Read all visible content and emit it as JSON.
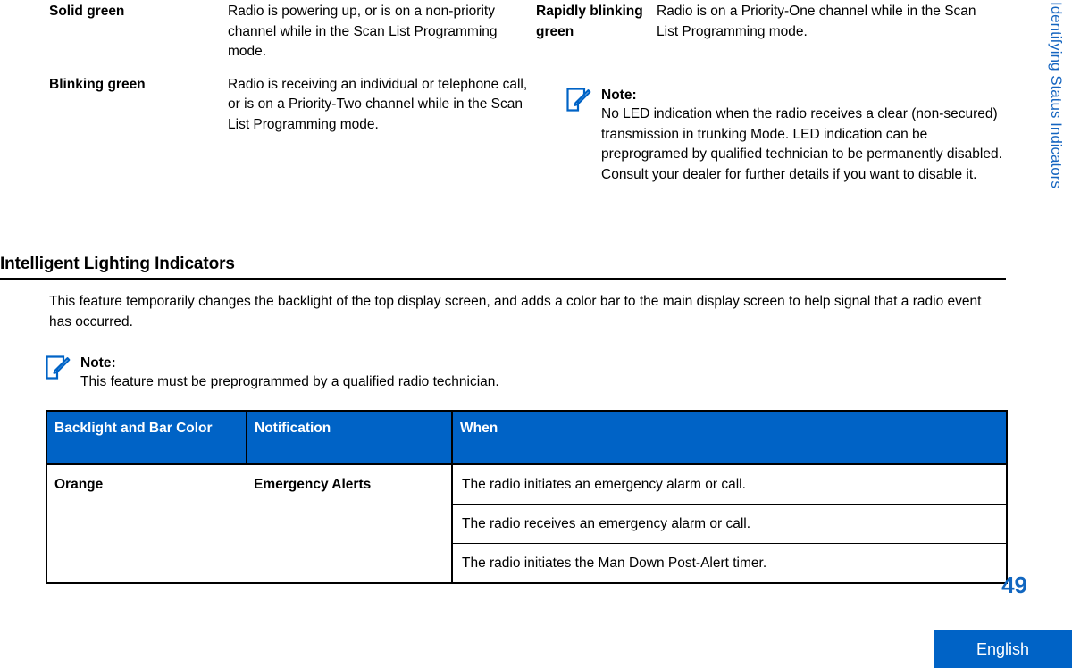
{
  "side_tab": {
    "label": "Identifying Status Indicators"
  },
  "led_table": {
    "left_rows": [
      {
        "term": "Solid green",
        "desc": "Radio is powering up, or is on a non-priority channel while in the Scan List Programming mode."
      },
      {
        "term": "Blinking green",
        "desc": "Radio is receiving an individual or telephone call, or is on a Priority-Two channel while in the Scan List Programming mode."
      }
    ],
    "right_rows": [
      {
        "term": "Rapidly blinking green",
        "desc": "Radio is on a Priority-One channel while in the Scan List Programming mode."
      }
    ]
  },
  "note_led": {
    "icon": "note-pencil-icon",
    "title": "Note:",
    "body": "No LED indication when the radio receives a clear (non-secured) transmission in trunking Mode. LED indication can be preprogramed by qualified technician to be permanently disabled. Consult your dealer for further details if you want to disable it."
  },
  "section": {
    "heading": "Intelligent Lighting Indicators",
    "paragraph": "This feature temporarily changes the backlight of the top display screen, and adds a color bar to the main display screen to help signal that a radio event has occurred."
  },
  "note_feature": {
    "icon": "note-pencil-icon",
    "title": "Note:",
    "body": "This feature must be preprogrammed by a qualified radio technician."
  },
  "lighting_table": {
    "headers": [
      "Backlight and Bar Color",
      "Notification",
      "When"
    ],
    "rows": [
      {
        "color": "Orange",
        "notification": "Emergency Alerts",
        "when": [
          "The radio initiates an emergency alarm or call.",
          "The radio receives an emergency alarm or call.",
          "The radio initiates the Man Down Post-Alert timer."
        ]
      }
    ]
  },
  "footer": {
    "page_number": "49",
    "language": "English"
  },
  "colors": {
    "header_blue": "#0063C6",
    "accent_blue": "#1565C0",
    "page_number_blue": "#1166C0",
    "rule_black": "#000000"
  }
}
